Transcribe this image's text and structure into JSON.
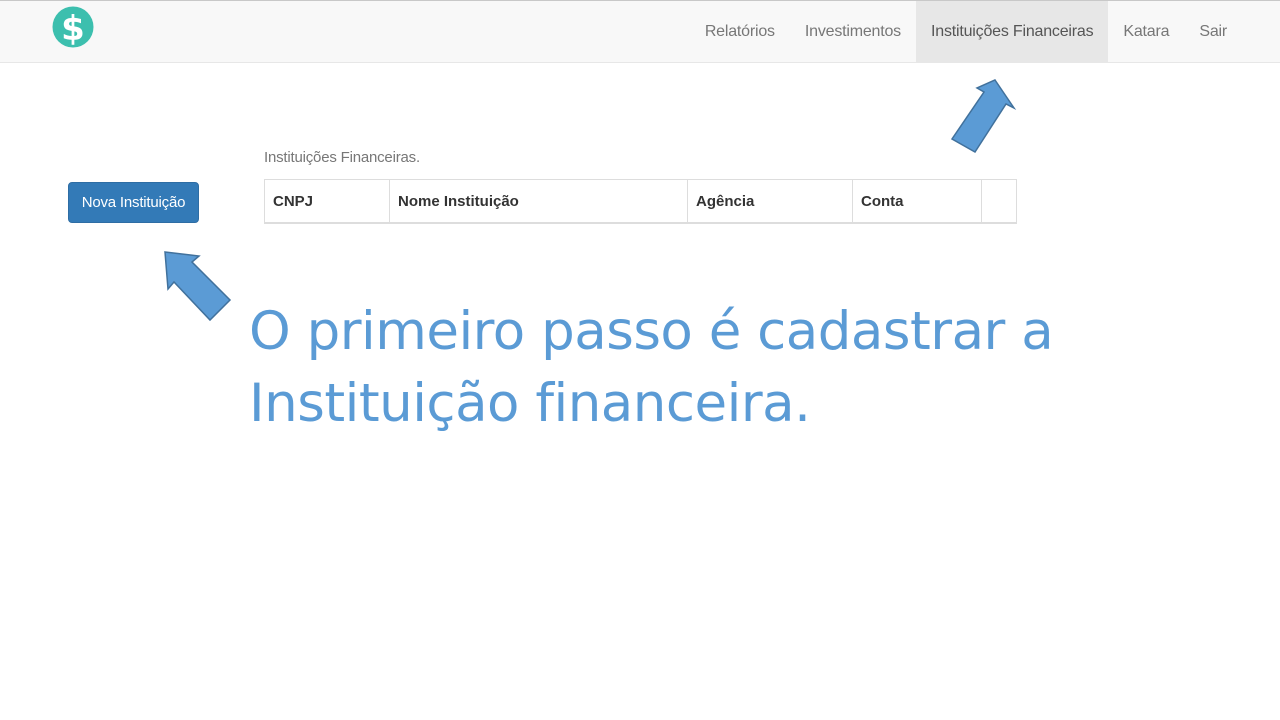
{
  "navbar": {
    "logo_icon": "dollar-coin-icon",
    "logo_color": "#3cbfae",
    "items": [
      {
        "label": "Relatórios",
        "active": false
      },
      {
        "label": "Investimentos",
        "active": false
      },
      {
        "label": "Instituições Financeiras",
        "active": true
      },
      {
        "label": "Katara",
        "active": false
      },
      {
        "label": "Sair",
        "active": false
      }
    ]
  },
  "actions": {
    "new_institution_label": "Nova Instituição"
  },
  "table": {
    "caption": "Instituições Financeiras.",
    "columns": [
      "CNPJ",
      "Nome Instituição",
      "Agência",
      "Conta",
      ""
    ],
    "rows": []
  },
  "annotation": {
    "line1": "O primeiro passo é cadastrar a",
    "line2": "Instituição financeira.",
    "color": "#5b9bd5",
    "arrow_color": "#5b9bd5"
  }
}
